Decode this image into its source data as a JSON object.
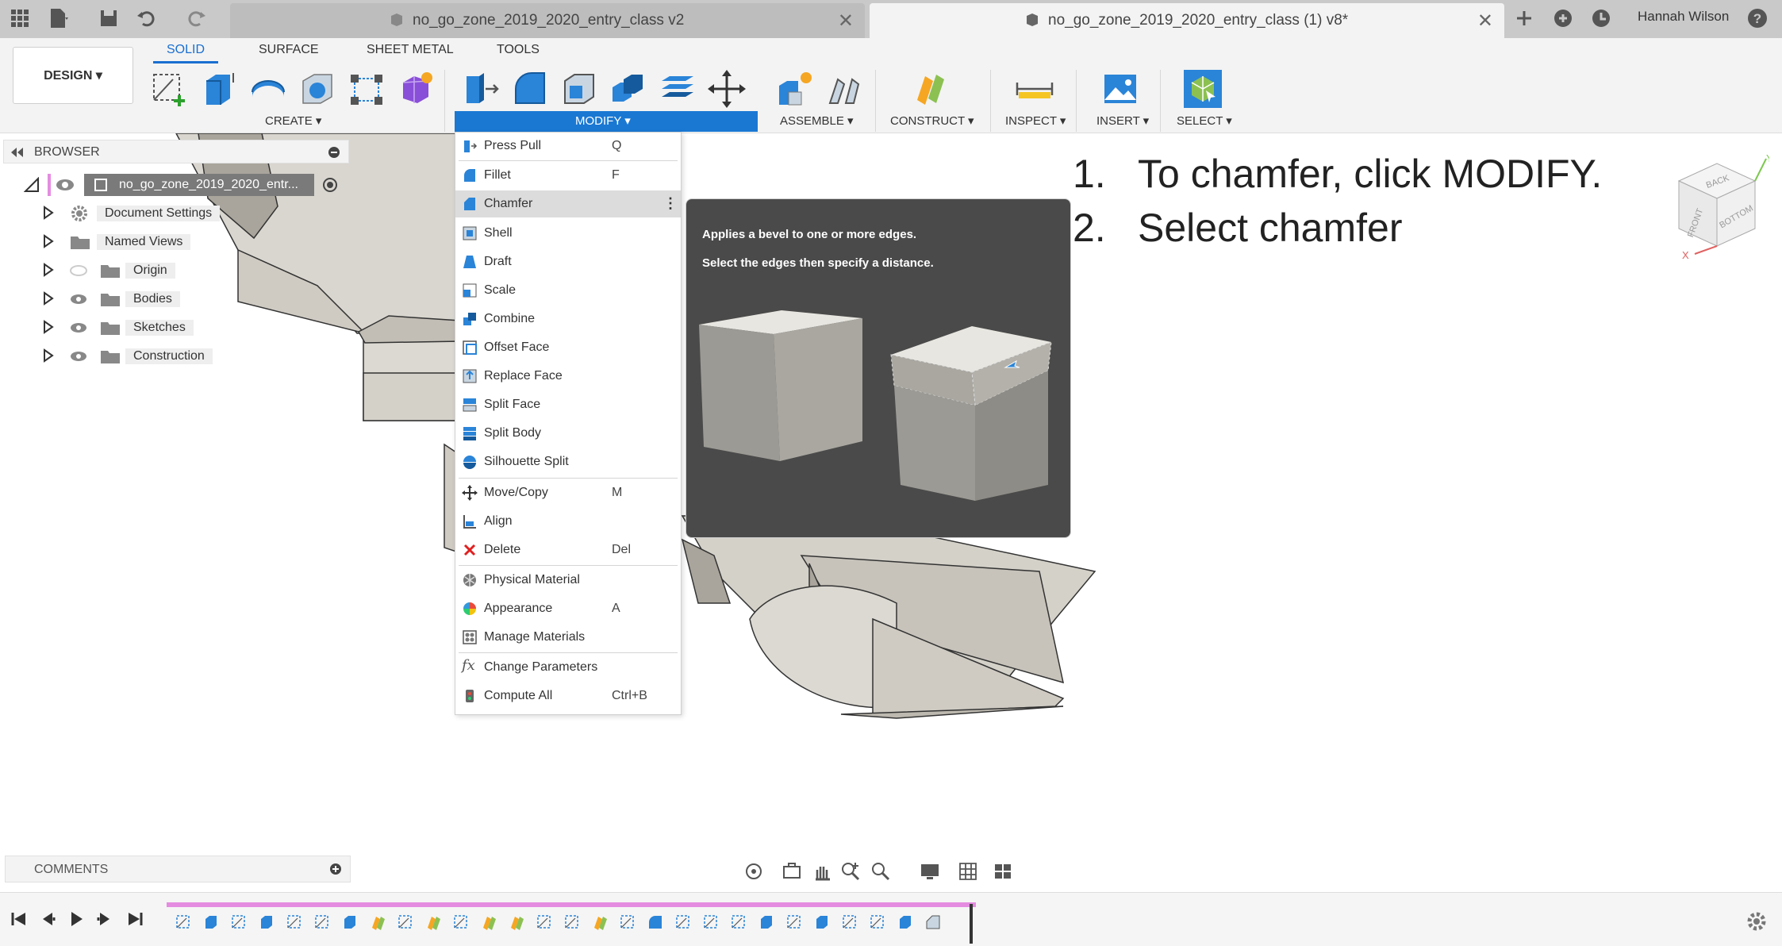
{
  "app": {
    "user_name": "Hannah Wilson"
  },
  "tabs": [
    {
      "label": "no_go_zone_2019_2020_entry_class v2",
      "active": false
    },
    {
      "label": "no_go_zone_2019_2020_entry_class (1) v8*",
      "active": true
    }
  ],
  "toolbar": {
    "design_label": "DESIGN ▾",
    "workspace_tabs": [
      "SOLID",
      "SURFACE",
      "SHEET METAL",
      "TOOLS"
    ],
    "groups": {
      "create": "CREATE ▾",
      "modify": "MODIFY ▾",
      "assemble": "ASSEMBLE ▾",
      "construct": "CONSTRUCT ▾",
      "inspect": "INSPECT ▾",
      "insert": "INSERT ▾",
      "select": "SELECT ▾"
    }
  },
  "browser": {
    "title": "BROWSER",
    "root": "no_go_zone_2019_2020_entr...",
    "items": [
      "Document Settings",
      "Named Views",
      "Origin",
      "Bodies",
      "Sketches",
      "Construction"
    ]
  },
  "modify_menu": {
    "items": [
      {
        "label": "Press Pull",
        "key": "Q"
      },
      {
        "label": "Fillet",
        "key": "F"
      },
      {
        "label": "Chamfer",
        "key": ""
      },
      {
        "label": "Shell",
        "key": ""
      },
      {
        "label": "Draft",
        "key": ""
      },
      {
        "label": "Scale",
        "key": ""
      },
      {
        "label": "Combine",
        "key": ""
      },
      {
        "label": "Offset Face",
        "key": ""
      },
      {
        "label": "Replace Face",
        "key": ""
      },
      {
        "label": "Split Face",
        "key": ""
      },
      {
        "label": "Split Body",
        "key": ""
      },
      {
        "label": "Silhouette Split",
        "key": ""
      },
      {
        "label": "Move/Copy",
        "key": "M"
      },
      {
        "label": "Align",
        "key": ""
      },
      {
        "label": "Delete",
        "key": "Del"
      },
      {
        "label": "Physical Material",
        "key": ""
      },
      {
        "label": "Appearance",
        "key": "A"
      },
      {
        "label": "Manage Materials",
        "key": ""
      },
      {
        "label": "Change Parameters",
        "key": ""
      },
      {
        "label": "Compute All",
        "key": "Ctrl+B"
      }
    ]
  },
  "tooltip": {
    "line1": "Applies a bevel to one or more edges.",
    "line2": "Select the edges then specify a distance."
  },
  "instructions": [
    {
      "num": "1.",
      "text": "To chamfer, click MODIFY."
    },
    {
      "num": "2.",
      "text": "Select chamfer"
    }
  ],
  "viewcube": {
    "faces": [
      "BACK",
      "FRONT",
      "BOTTOM"
    ],
    "axes": [
      "X",
      "Y"
    ]
  },
  "comments": {
    "label": "COMMENTS"
  },
  "colors": {
    "accent": "#1a78d3",
    "timeline_track": "#e48ce0",
    "menu_highlight": "#dcdcdc",
    "tooltip_bg": "#4a4a4a"
  }
}
